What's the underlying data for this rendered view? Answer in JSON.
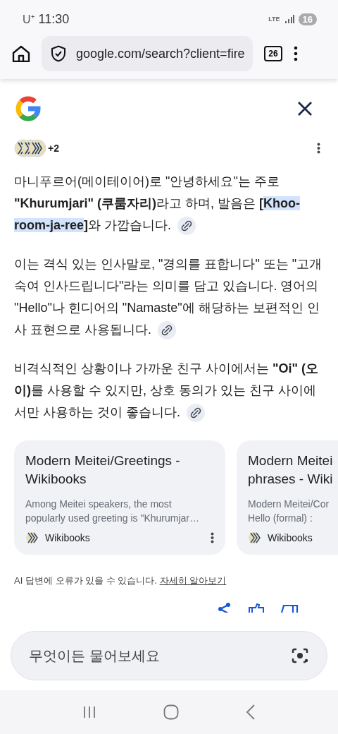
{
  "status_bar": {
    "carrier": "U⁺",
    "time": "11:30",
    "network": "LTE",
    "battery": "16"
  },
  "browser": {
    "url": "google.com/search?client=fire",
    "tab_count": "26"
  },
  "answer": {
    "source_count": "+2",
    "paragraphs": [
      {
        "segments": [
          {
            "text": "마니푸르어(메이테이어)로 \"안녕하세요\"는 주로 ",
            "bold": false,
            "highlighted": false
          },
          {
            "text": "\"Khurumjari\" (쿠룸자리)",
            "bold": true,
            "highlighted": false
          },
          {
            "text": "라고 하며, 발음은 ",
            "bold": false,
            "highlighted": false
          },
          {
            "text": "[",
            "bold": true,
            "highlighted": false
          },
          {
            "text": "Khoo-room-ja-ree",
            "bold": true,
            "highlighted": true
          },
          {
            "text": "]",
            "bold": true,
            "highlighted": false
          },
          {
            "text": "와 가깝습니다.",
            "bold": false,
            "highlighted": false
          }
        ]
      },
      {
        "segments": [
          {
            "text": "이는 격식 있는 인사말로, \"경의를 표합니다\" 또는 \"고개 숙여 인사드립니다\"라는 의미를 담고 있습니다. 영어의 \"Hello\"나 힌디어의 \"Namaste\"에 해당하는 보편적인 인사 표현으로 사용됩니다.",
            "bold": false,
            "highlighted": false
          }
        ]
      },
      {
        "segments": [
          {
            "text": "비격식적인 상황이나 가까운 친구 사이에서는 ",
            "bold": false,
            "highlighted": false
          },
          {
            "text": "\"Oi\" (오이)",
            "bold": true,
            "highlighted": false
          },
          {
            "text": "를 사용할 수 있지만, 상호 동의가 있는 친구 사이에서만 사용하는 것이 좋습니다.",
            "bold": false,
            "highlighted": false
          }
        ]
      }
    ],
    "sources": [
      {
        "title": "Modern Meitei/Greetings - Wikibooks",
        "snippet": "Among Meitei speakers, the most popularly used greeting is \"Khurumjar…",
        "site": "Wikibooks"
      },
      {
        "title": "Modern Meitei phrases - Wiki",
        "snippet": "Modern Meitei/Cor Hello (formal) :",
        "site": "Wikibooks"
      }
    ],
    "disclaimer": "AI 답변에 오류가 있을 수 있습니다.",
    "learn_more": "자세히 알아보기"
  },
  "ask_field": {
    "placeholder": "무엇이든 물어보세요"
  }
}
